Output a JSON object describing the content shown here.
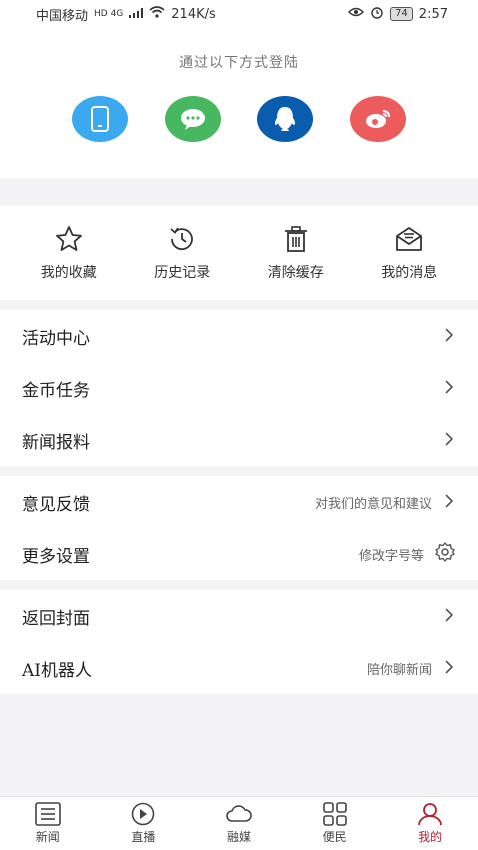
{
  "status_bar": {
    "carrier": "中国移动",
    "network": "HD 4G",
    "speed": "214K/s",
    "battery": "74",
    "time": "2:57"
  },
  "login": {
    "title": "通过以下方式登陆",
    "methods": [
      {
        "name": "phone",
        "icon": "phone-icon",
        "color": "#3aa9f0"
      },
      {
        "name": "wechat",
        "icon": "wechat-icon",
        "color": "#47b85f"
      },
      {
        "name": "qq",
        "icon": "qq-icon",
        "color": "#0a5cae"
      },
      {
        "name": "weibo",
        "icon": "weibo-icon",
        "color": "#ec5c5c"
      }
    ]
  },
  "quick_actions": [
    {
      "label": "我的收藏",
      "icon": "star-icon"
    },
    {
      "label": "历史记录",
      "icon": "history-icon"
    },
    {
      "label": "清除缓存",
      "icon": "trash-icon"
    },
    {
      "label": "我的消息",
      "icon": "message-icon"
    }
  ],
  "menu_groups": [
    [
      {
        "label": "活动中心",
        "hint": ""
      },
      {
        "label": "金币任务",
        "hint": ""
      },
      {
        "label": "新闻报料",
        "hint": ""
      }
    ],
    [
      {
        "label": "意见反馈",
        "hint": "对我们的意见和建议"
      },
      {
        "label": "更多设置",
        "hint": "修改字号等"
      }
    ],
    [
      {
        "label": "返回封面",
        "hint": ""
      },
      {
        "label": "AI机器人",
        "hint": "陪你聊新闻"
      }
    ]
  ],
  "tab_bar": [
    {
      "label": "新闻",
      "icon": "news-icon"
    },
    {
      "label": "直播",
      "icon": "play-icon"
    },
    {
      "label": "融媒",
      "icon": "cloud-icon"
    },
    {
      "label": "便民",
      "icon": "grid-icon"
    },
    {
      "label": "我的",
      "icon": "user-icon",
      "active": true
    }
  ],
  "accent_color": "#b22030"
}
